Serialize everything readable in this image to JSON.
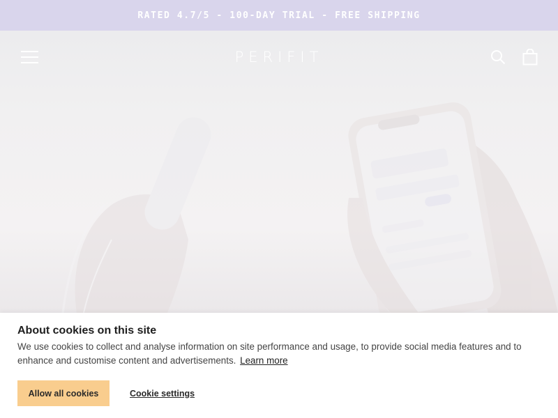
{
  "announcement": {
    "text": "RATED 4.7/5 - 100-DAY TRIAL - FREE SHIPPING"
  },
  "header": {
    "logo": "PERIFIT",
    "menu_icon": "hamburger-menu-icon",
    "search_icon": "search-icon",
    "cart_icon": "shopping-bag-icon"
  },
  "hero": {
    "image": "hands holding pelvic floor trainer and smartphone app"
  },
  "cookie_banner": {
    "title": "About cookies on this site",
    "text": "We use cookies to collect and analyse information on site performance and usage, to provide social media features and to enhance and customise content and advertisements.",
    "learn_more": "Learn more",
    "allow_button": "Allow all cookies",
    "settings_button": "Cookie settings"
  },
  "colors": {
    "announcement_bg": "#d9d5ec",
    "allow_button_bg": "#f9cd8e"
  }
}
